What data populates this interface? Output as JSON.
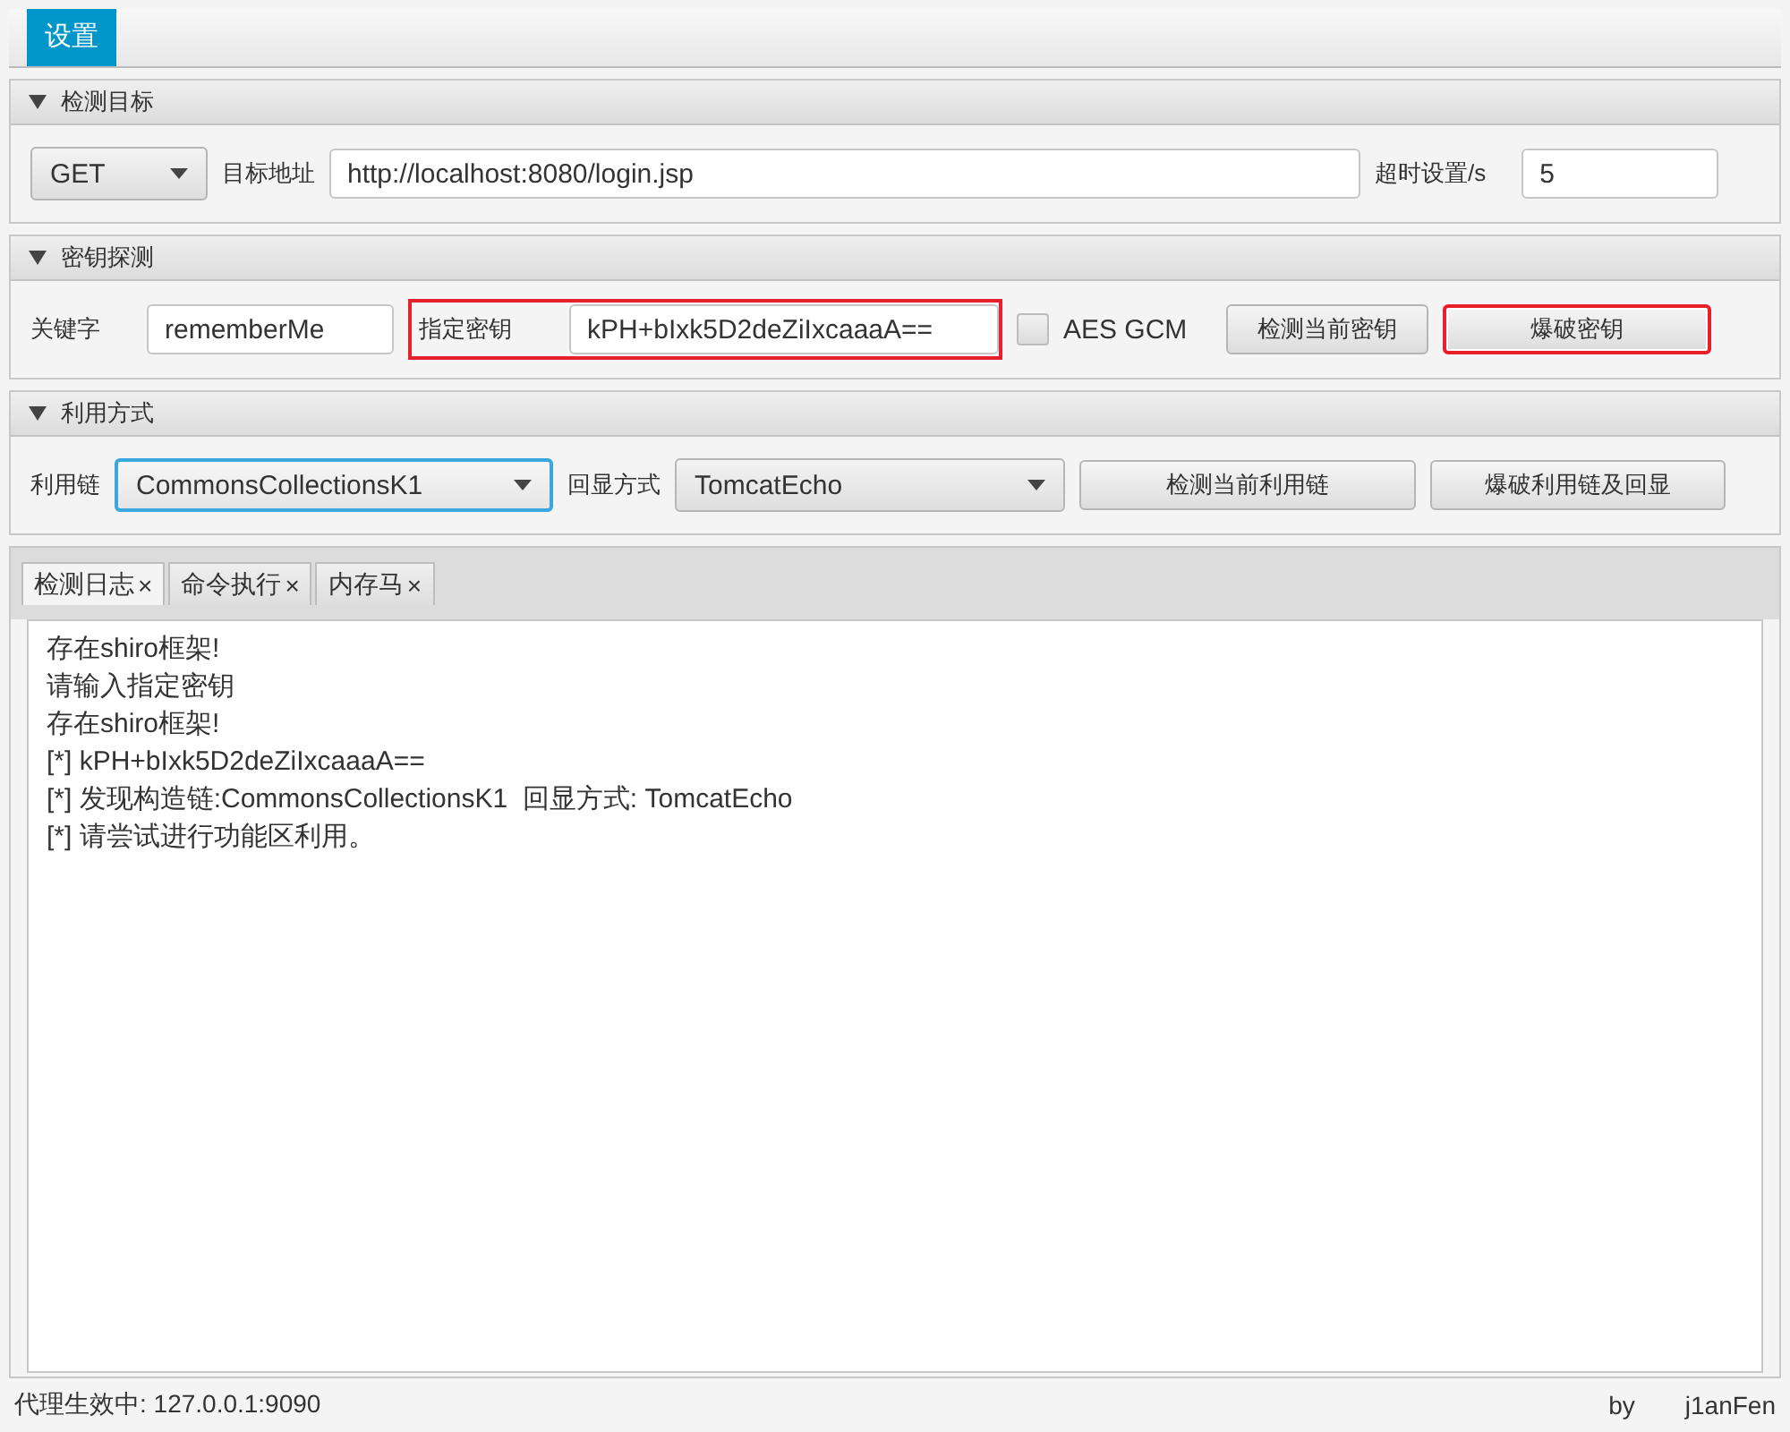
{
  "top_tabs": [
    {
      "label": "设置",
      "selected": true
    }
  ],
  "sections": [
    {
      "title": "检测目标",
      "expanded": true,
      "controls": [
        {
          "kind": "dropdown",
          "value": "GET",
          "focused": false
        },
        {
          "kind": "label",
          "text": "目标地址"
        },
        {
          "kind": "field",
          "value": "http://localhost:8080/login.jsp"
        },
        {
          "kind": "label",
          "text": "超时设置/s"
        },
        {
          "kind": "field",
          "value": "5"
        }
      ]
    },
    {
      "title": "密钥探测",
      "expanded": true,
      "controls": [
        {
          "kind": "label",
          "text": "关键字"
        },
        {
          "kind": "field",
          "value": "rememberMe"
        },
        {
          "kind": "group",
          "highlighted": true,
          "items": [
            {
              "kind": "label",
              "text": "指定密钥"
            },
            {
              "kind": "field",
              "value": "kPH+bIxk5D2deZiIxcaaaA=="
            }
          ]
        },
        {
          "kind": "checkbox",
          "text": "AES GCM",
          "checked": false
        },
        {
          "kind": "button",
          "text": "检测当前密钥",
          "highlighted": false
        },
        {
          "kind": "button",
          "text": "爆破密钥",
          "highlighted": true
        }
      ]
    },
    {
      "title": "利用方式",
      "expanded": true,
      "controls": [
        {
          "kind": "label",
          "text": "利用链"
        },
        {
          "kind": "dropdown",
          "value": "CommonsCollectionsK1",
          "focused": true
        },
        {
          "kind": "label",
          "text": "回显方式"
        },
        {
          "kind": "dropdown",
          "value": "TomcatEcho",
          "focused": false
        },
        {
          "kind": "button",
          "text": "检测当前利用链",
          "highlighted": false
        },
        {
          "kind": "button",
          "text": "爆破利用链及回显",
          "highlighted": false
        }
      ]
    }
  ],
  "output_tabs": [
    {
      "label": "检测日志",
      "close": "×",
      "selected": true
    },
    {
      "label": "命令执行",
      "close": "×",
      "selected": false
    },
    {
      "label": "内存马",
      "close": "×",
      "selected": false
    }
  ],
  "log_lines": [
    "存在shiro框架!",
    "请输入指定密钥",
    "存在shiro框架!",
    "[*] kPH+bIxk5D2deZiIxcaaaA==",
    "[*] 发现构造链:CommonsCollectionsK1  回显方式: TomcatEcho",
    "[*] 请尝试进行功能区利用。"
  ],
  "status_bar": {
    "proxy": "代理生效中: 127.0.0.1:9090",
    "by": "by",
    "author": "j1anFen"
  }
}
